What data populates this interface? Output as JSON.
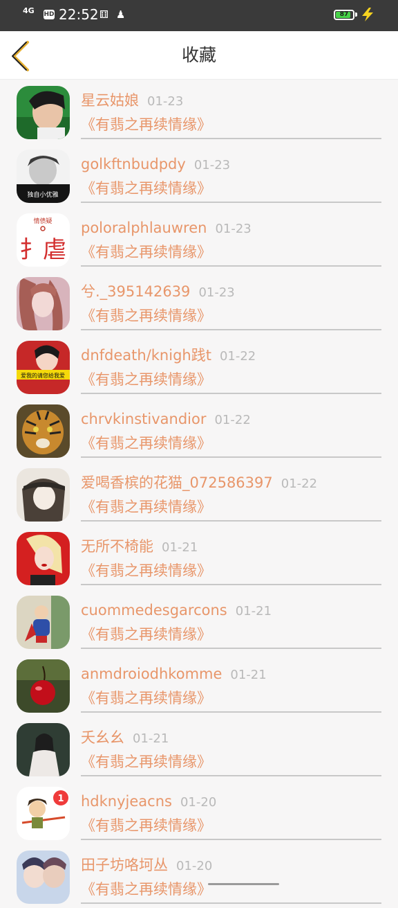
{
  "status_bar": {
    "signal": "4G",
    "hd_badge": "HD",
    "time": "22:52",
    "battery_level": 87,
    "battery_text": "87",
    "battery_color": "#46d348"
  },
  "header": {
    "title": "收藏",
    "back_icon": "chevron-left-icon",
    "accent_color": "#e8966a"
  },
  "favorites": [
    {
      "name": "星云姑娘",
      "date": "01-23",
      "title": "《有翡之再续情缘》"
    },
    {
      "name": "golkftnbudpdy",
      "date": "01-23",
      "title": "《有翡之再续情缘》"
    },
    {
      "name": "poloralphlauwren",
      "date": "01-23",
      "title": "《有翡之再续情缘》"
    },
    {
      "name": "兮._395142639",
      "date": "01-23",
      "title": "《有翡之再续情缘》"
    },
    {
      "name": "dnfdeath/knigh践t",
      "date": "01-22",
      "title": "《有翡之再续情缘》"
    },
    {
      "name": "chrvkinstivandior",
      "date": "01-22",
      "title": "《有翡之再续情缘》"
    },
    {
      "name": "爱喝香槟的花猫_072586397",
      "date": "01-22",
      "title": "《有翡之再续情缘》"
    },
    {
      "name": "无所不椅能",
      "date": "01-21",
      "title": "《有翡之再续情缘》"
    },
    {
      "name": "cuommedesgarcons",
      "date": "01-21",
      "title": "《有翡之再续情缘》"
    },
    {
      "name": "anmdroiodhkomme",
      "date": "01-21",
      "title": "《有翡之再续情缘》"
    },
    {
      "name": "夭幺幺",
      "date": "01-21",
      "title": "《有翡之再续情缘》"
    },
    {
      "name": "hdknyjeacns",
      "date": "01-20",
      "title": "《有翡之再续情缘》"
    },
    {
      "name": "田子坊咯坷丛",
      "date": "01-20",
      "title": "《有翡之再续情缘》"
    }
  ],
  "avatar_texts": {
    "avatar_2": "独自小优雅",
    "avatar_3_top": "情债疑",
    "avatar_3_main": "扌虐",
    "avatar_5": "爱我的请您给我爱",
    "avatar_12_badge": "1"
  }
}
